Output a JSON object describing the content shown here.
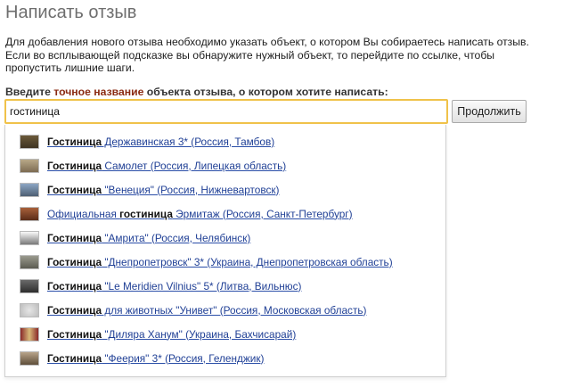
{
  "page": {
    "title": "Написать отзыв",
    "intro_line1": "Для добавления нового отзыва необходимо указать объект, о котором Вы собираетесь написать отзыв.",
    "intro_line2": "Если во всплывающей подсказке вы обнаружите нужный объект, то перейдите по ссылке, чтобы",
    "intro_line3": "пропустить лишние шаги."
  },
  "form": {
    "prompt_before": "Введите ",
    "prompt_accent": "точное название",
    "prompt_after": " объекта отзыва, о котором хотите написать:",
    "input_value": "гостиница",
    "submit_label": "Продолжить"
  },
  "colors": {
    "input_border": "#f0c24a",
    "prompt_accent": "#8a2a12",
    "link": "#1f3f95"
  },
  "suggestions": [
    {
      "before": "",
      "keyword": "Гостиница",
      "after": " Державинская 3* (Россия, Тамбов)",
      "thumb": "linear-gradient(#6b5a3a,#3e3322)"
    },
    {
      "before": "",
      "keyword": "Гостиница",
      "after": " Самолет (Россия, Липецкая область)",
      "thumb": "linear-gradient(#b8a888,#7d6c52)"
    },
    {
      "before": "",
      "keyword": "Гостиница",
      "after": " \"Венеция\" (Россия, Нижневартовск)",
      "thumb": "linear-gradient(#8ca6c4,#4e5f73)"
    },
    {
      "before": "Официальная ",
      "keyword": "гостиница",
      "after": " Эрмитаж (Россия, Санкт-Петербург)",
      "thumb": "linear-gradient(#a8603a,#5a2c18)"
    },
    {
      "before": "",
      "keyword": "Гостиница",
      "after": " \"Амрита\" (Россия, Челябинск)",
      "thumb": "linear-gradient(#fafafa,#7a7a7a)"
    },
    {
      "before": "",
      "keyword": "Гостиница",
      "after": " \"Днепропетровск\" 3* (Украина, Днепропетровская область)",
      "thumb": "linear-gradient(#9a9a8e,#5c5c52)"
    },
    {
      "before": "",
      "keyword": "Гостиница",
      "after": " \"Le Meridien Vilnius\" 5* (Литва, Вильнюс)",
      "thumb": "linear-gradient(#6a6a6a,#2e2e2e)"
    },
    {
      "before": "",
      "keyword": "Гостиница",
      "after": " для животных \"Унивет\" (Россия, Московская область)",
      "thumb": "radial-gradient(circle,#e6e6e6,#bdbdbd)"
    },
    {
      "before": "",
      "keyword": "Гостиница",
      "after": " \"Диляра Ханум\" (Украина, Бахчисарай)",
      "thumb": "linear-gradient(90deg,#8a2a2a,#d8b878,#8a2a2a)"
    },
    {
      "before": "",
      "keyword": "Гостиница",
      "after": " \"Феерия\" 3* (Россия, Геленджик)",
      "thumb": "linear-gradient(#b8a48a,#5e4e3a)"
    }
  ]
}
